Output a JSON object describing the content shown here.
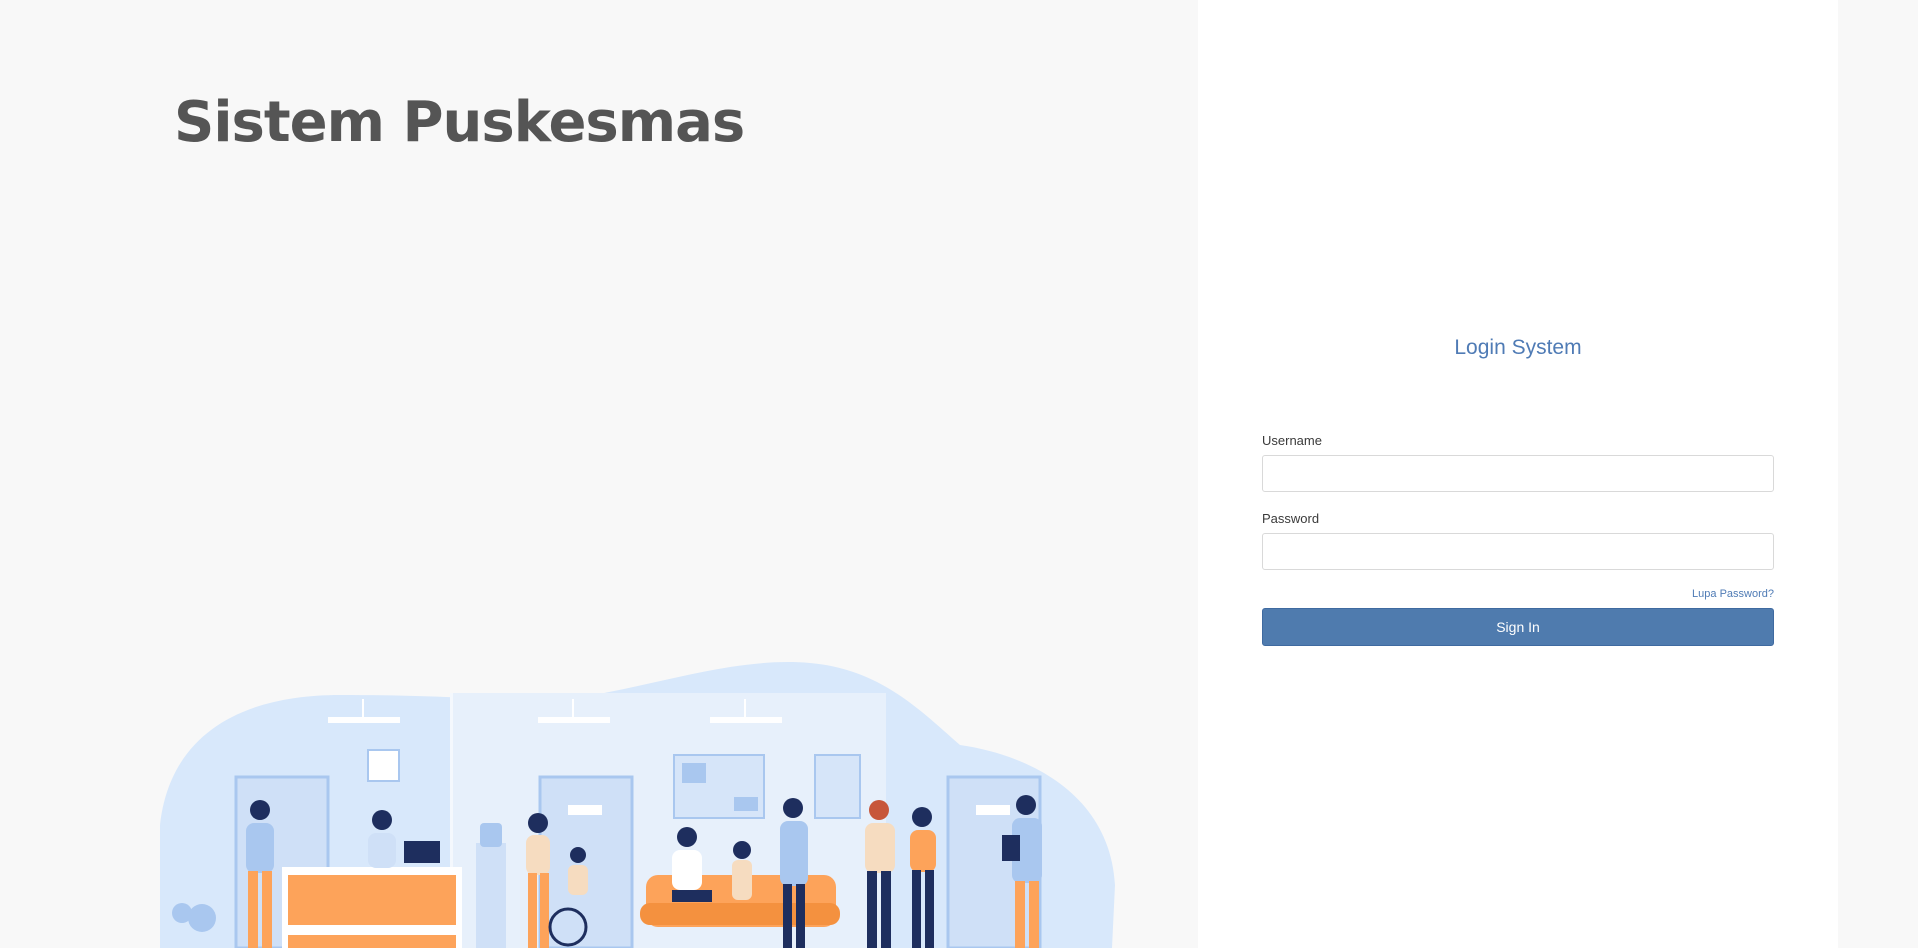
{
  "app": {
    "title": "Sistem Puskesmas"
  },
  "login": {
    "title": "Login System",
    "username_label": "Username",
    "username_value": "",
    "password_label": "Password",
    "password_value": "",
    "forgot_label": "Lupa Password?",
    "signin_label": "Sign In"
  },
  "colors": {
    "accent": "#4f7bb5",
    "button": "#4f7bae",
    "title_text": "#555555",
    "background_left": "#f8f8f8",
    "panel": "#ffffff",
    "illustration_orange": "#fda35a",
    "illustration_blue": "#d8e8fb",
    "illustration_navy": "#1e2e5e"
  }
}
